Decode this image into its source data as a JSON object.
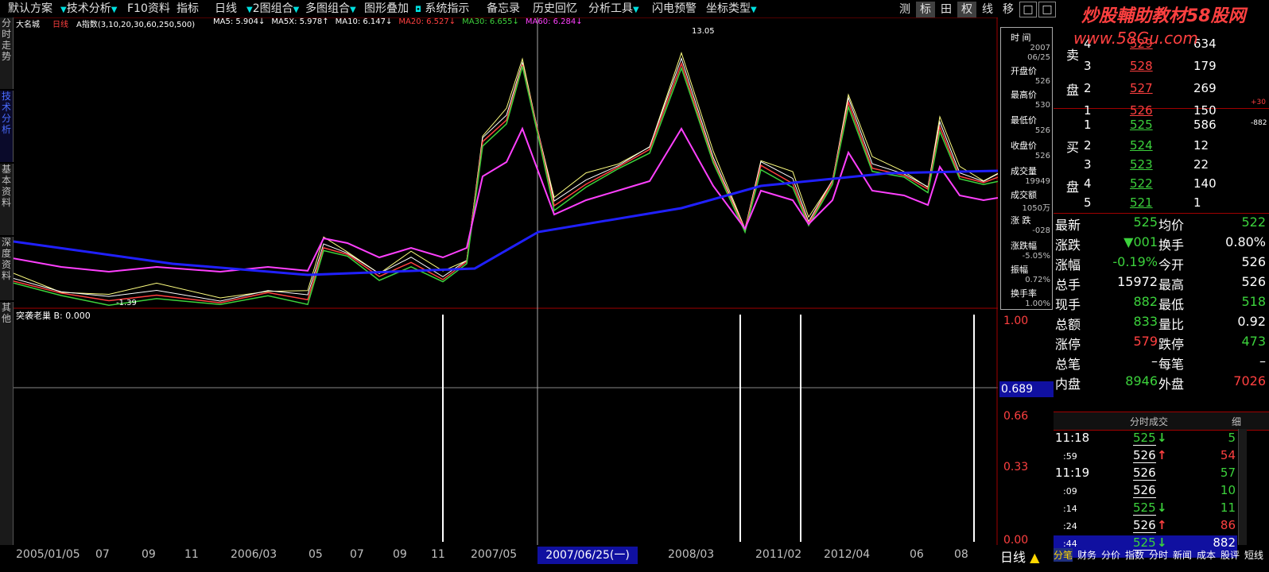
{
  "toolbar": {
    "items": [
      "默认方案",
      "技术分析",
      "F10资料",
      "指标",
      "日线",
      "2图组合",
      "多图组合",
      "图形叠加",
      "系统指示",
      "备忘录",
      "历史回忆",
      "分析工具",
      "闪电预警",
      "坐标类型"
    ],
    "right_items": [
      "测",
      "标",
      "田",
      "权",
      "线",
      "移",
      "□",
      "□"
    ]
  },
  "brand": {
    "title": "炒股輔助教材58股网",
    "url": "www.58Gu.com"
  },
  "left_tabs": [
    "分时走势",
    "技术分析",
    "基本资料",
    "深度资料",
    "其他"
  ],
  "chart": {
    "stock_name": "大名城",
    "period": "日线",
    "indicator": "A指数(3,10,20,30,60,250,500)",
    "ma_legend": [
      {
        "text": "MA5: 5.904↓",
        "color": "#ffffff"
      },
      {
        "text": "MA5X: 5.978↑",
        "color": "#ffffff"
      },
      {
        "text": "MA10: 6.147↓",
        "color": "#ffffff"
      },
      {
        "text": "MA20: 6.527↓",
        "color": "#ff4040"
      },
      {
        "text": "MA30: 6.655↓",
        "color": "#3cd23c"
      },
      {
        "text": "MA60: 6.284↓",
        "color": "#ff40ff"
      }
    ],
    "low_label": "-1.39",
    "peak_label": "13.05",
    "sub_indicator": "突袭老巢 B: 0.000",
    "y_labels": [
      "1.00",
      "0.66",
      "0.33",
      "0.00"
    ],
    "current_value": "0.689"
  },
  "info_panel": {
    "items": [
      {
        "label": "时 间",
        "value": ""
      },
      {
        "label": "",
        "value": "2007"
      },
      {
        "label": "",
        "value": "06/25"
      },
      {
        "label": "开盘价",
        "value": "526"
      },
      {
        "label": "最高价",
        "value": "530"
      },
      {
        "label": "最低价",
        "value": "526"
      },
      {
        "label": "收盘价",
        "value": "526"
      },
      {
        "label": "成交量",
        "value": "19949"
      },
      {
        "label": "成交额",
        "value": "1050万"
      },
      {
        "label": "涨 跌",
        "value": "-028"
      },
      {
        "label": "涨跌幅",
        "value": "-5.05%"
      },
      {
        "label": "振幅",
        "value": "0.72%"
      },
      {
        "label": "换手率",
        "value": "1.00%"
      }
    ]
  },
  "orderbook": {
    "sell_label": [
      "卖",
      "盘"
    ],
    "buy_label": [
      "买",
      "盘"
    ],
    "sell": [
      {
        "level": "4",
        "price": "529",
        "vol": "634"
      },
      {
        "level": "3",
        "price": "528",
        "vol": "179"
      },
      {
        "level": "2",
        "price": "527",
        "vol": "269"
      },
      {
        "level": "1",
        "price": "526",
        "vol": "150"
      }
    ],
    "buy": [
      {
        "level": "1",
        "price": "525",
        "vol": "586"
      },
      {
        "level": "2",
        "price": "524",
        "vol": "12"
      },
      {
        "level": "3",
        "price": "523",
        "vol": "22"
      },
      {
        "level": "4",
        "price": "522",
        "vol": "140"
      },
      {
        "level": "5",
        "price": "521",
        "vol": "1"
      }
    ],
    "side_note1": "+30",
    "side_note2": "-882"
  },
  "stats": [
    {
      "l1": "最新",
      "v1": "525",
      "c1": "green",
      "l2": "均价",
      "v2": "522",
      "c2": "green"
    },
    {
      "l1": "涨跌",
      "v1": "▼001",
      "c1": "green",
      "l2": "换手",
      "v2": "0.80%",
      "c2": "white"
    },
    {
      "l1": "涨幅",
      "v1": "-0.19%",
      "c1": "green",
      "l2": "今开",
      "v2": "526",
      "c2": "white"
    },
    {
      "l1": "总手",
      "v1": "15972",
      "c1": "white",
      "l2": "最高",
      "v2": "526",
      "c2": "white"
    },
    {
      "l1": "现手",
      "v1": "882",
      "c1": "green",
      "l2": "最低",
      "v2": "518",
      "c2": "green"
    },
    {
      "l1": "总额",
      "v1": "833",
      "c1": "green",
      "l2": "量比",
      "v2": "0.92",
      "c2": "white"
    },
    {
      "l1": "涨停",
      "v1": "579",
      "c1": "red",
      "l2": "跌停",
      "v2": "473",
      "c2": "green"
    },
    {
      "l1": "总笔",
      "v1": "–",
      "c1": "white",
      "l2": "每笔",
      "v2": "–",
      "c2": "white"
    },
    {
      "l1": "内盘",
      "v1": "8946",
      "c1": "green",
      "l2": "外盘",
      "v2": "7026",
      "c2": "red"
    }
  ],
  "ticks": {
    "header": "分时成交",
    "header_right": "细",
    "rows": [
      {
        "time": "11:18",
        "price": "525",
        "dir": "↓",
        "vol": "5",
        "pc": "green",
        "vc": "green"
      },
      {
        "time": ":59",
        "price": "526",
        "dir": "↑",
        "vol": "54",
        "pc": "white",
        "vc": "red"
      },
      {
        "time": "11:19",
        "price": "526",
        "dir": "",
        "vol": "57",
        "pc": "white",
        "vc": "green"
      },
      {
        "time": ":09",
        "price": "526",
        "dir": "",
        "vol": "10",
        "pc": "white",
        "vc": "green"
      },
      {
        "time": ":14",
        "price": "525",
        "dir": "↓",
        "vol": "11",
        "pc": "green",
        "vc": "green"
      },
      {
        "time": ":24",
        "price": "526",
        "dir": "↑",
        "vol": "86",
        "pc": "white",
        "vc": "red"
      },
      {
        "time": ":44",
        "price": "525",
        "dir": "↓",
        "vol": "882",
        "pc": "green",
        "vc": "white"
      }
    ]
  },
  "dates": [
    "2005/01/05",
    "07",
    "09",
    "11",
    "2006/03",
    "05",
    "07",
    "09",
    "11",
    "2007/05",
    "2008/03",
    "2011/02",
    "2012/04",
    "06",
    "08"
  ],
  "date_badge": "2007/06/25(一)",
  "period_label": "日线",
  "bottom_tabs": [
    "分笔",
    "财务",
    "分价",
    "指数",
    "分时",
    "新闻",
    "成本",
    "股评",
    "短线"
  ]
}
